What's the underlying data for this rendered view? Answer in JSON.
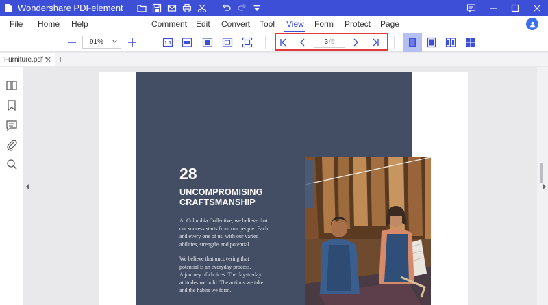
{
  "window": {
    "title": "Wondershare PDFelement",
    "quick_icons": [
      "folder-icon",
      "save-icon",
      "mail-icon",
      "print-icon",
      "scissors-icon",
      "undo-icon",
      "redo-icon",
      "dropdown-icon"
    ],
    "controls": [
      "feedback-icon",
      "minimize-icon",
      "maximize-icon",
      "close-icon"
    ]
  },
  "menu": {
    "file": "File",
    "home": "Home",
    "help": "Help",
    "comment": "Comment",
    "edit": "Edit",
    "convert": "Convert",
    "tool": "Tool",
    "view": "View",
    "form": "Form",
    "protect": "Protect",
    "page": "Page",
    "active": "View"
  },
  "toolbar": {
    "zoom_value": "91%",
    "current_page": "3",
    "total_pages": "/5",
    "zoom_out_icon": "minus-icon",
    "zoom_in_icon": "plus-icon",
    "accent_color": "#3c4fd6",
    "highlight_color": "#e23a3a"
  },
  "tabs": [
    {
      "label": "Furniture.pdf *"
    }
  ],
  "document": {
    "number": "28",
    "headline_line1": "UNCOMPROMISING",
    "headline_line2": "CRAFTSMANSHIP",
    "para1": [
      "At Columbia Collective, we believe that",
      "our success starts from our people. Each",
      "and every one of us, with our varied",
      "abilities, strengths and potential."
    ],
    "para2": [
      "We believe that uncovering that",
      "potential is an everyday process.",
      "A journey of choices: The day-to-day",
      "attitudes we hold. The actions we take",
      "and the habits we form."
    ],
    "slate_color": "#434e64"
  }
}
